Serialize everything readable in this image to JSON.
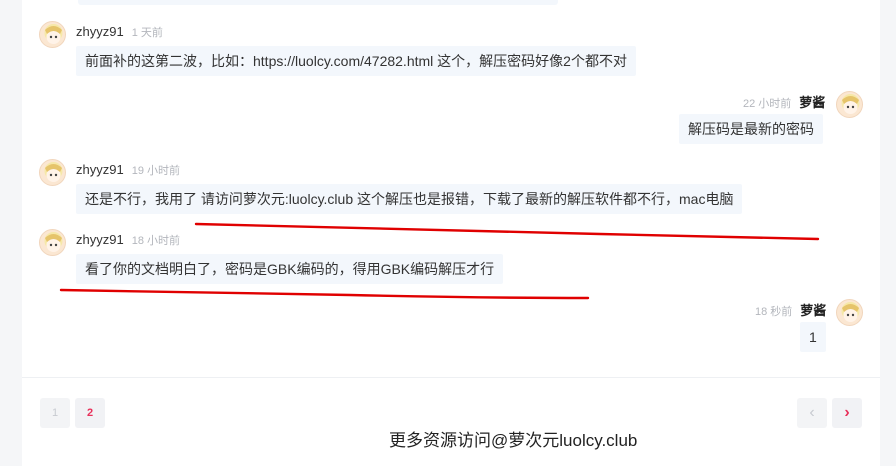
{
  "messages": [
    {
      "user": "zhyyz91",
      "time": "1 天前",
      "text": "前面补的这第二波，比如：https://luolcy.com/47282.html 这个，解压密码好像2个都不对"
    },
    {
      "user": "萝酱",
      "time": "22 小时前",
      "text": "解压码是最新的密码"
    },
    {
      "user": "zhyyz91",
      "time": "19 小时前",
      "text": "还是不行，我用了 请访问萝次元:luolcy.club 这个解压也是报错，下载了最新的解压软件都不行，mac电脑"
    },
    {
      "user": "zhyyz91",
      "time": "18 小时前",
      "text": "看了你的文档明白了，密码是GBK编码的，得用GBK编码解压才行"
    },
    {
      "user": "萝酱",
      "time": "18 秒前",
      "text": "1"
    }
  ],
  "pagination": {
    "page1": "1",
    "page2": "2",
    "prev": "‹",
    "next": "›"
  },
  "watermark": "更多资源访问@萝次元luolcy.club",
  "colors": {
    "accent": "#e8305a",
    "bubble_bg": "#f3f7fc",
    "annotation": "#e00000"
  },
  "icons": {
    "avatar": "anime-avatar-icon",
    "prev": "chevron-left-icon",
    "next": "chevron-right-icon"
  }
}
